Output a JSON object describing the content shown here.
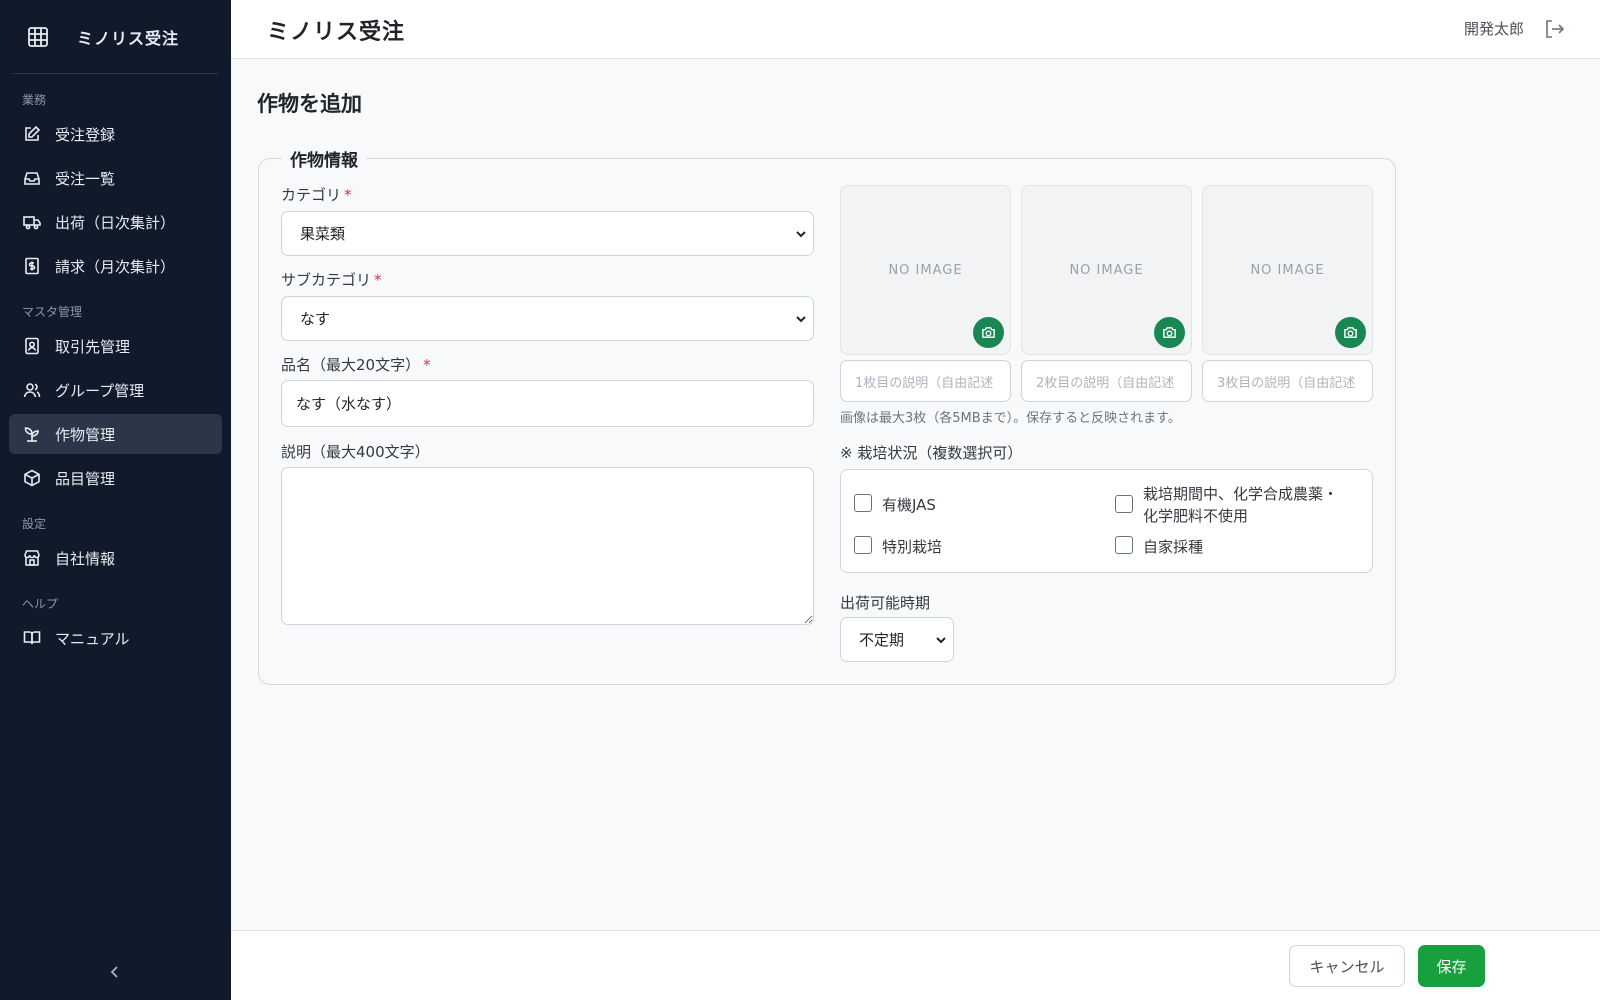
{
  "sidebar": {
    "brand": "ミノリス受注",
    "sections": [
      {
        "label": "業務",
        "items": [
          {
            "label": "受注登録",
            "icon": "edit-icon"
          },
          {
            "label": "受注一覧",
            "icon": "inbox-icon"
          },
          {
            "label": "出荷（日次集計）",
            "icon": "truck-icon"
          },
          {
            "label": "請求（月次集計）",
            "icon": "invoice-icon"
          }
        ]
      },
      {
        "label": "マスタ管理",
        "items": [
          {
            "label": "取引先管理",
            "icon": "contact-card-icon"
          },
          {
            "label": "グループ管理",
            "icon": "people-icon"
          },
          {
            "label": "作物管理",
            "icon": "sprout-icon",
            "active": true
          },
          {
            "label": "品目管理",
            "icon": "box-icon"
          }
        ]
      },
      {
        "label": "設定",
        "items": [
          {
            "label": "自社情報",
            "icon": "shop-icon"
          }
        ]
      },
      {
        "label": "ヘルプ",
        "items": [
          {
            "label": "マニュアル",
            "icon": "book-icon"
          }
        ]
      }
    ]
  },
  "header": {
    "title": "ミノリス受注",
    "user": "開発太郎"
  },
  "page": {
    "title": "作物を追加",
    "legend": "作物情報"
  },
  "form": {
    "category": {
      "label": "カテゴリ",
      "value": "果菜類",
      "required_mark": "*"
    },
    "subcategory": {
      "label": "サブカテゴリ",
      "value": "なす",
      "required_mark": "*"
    },
    "name": {
      "label": "品名（最大20文字）",
      "value": "なす（水なす）",
      "required_mark": "*"
    },
    "description": {
      "label": "説明（最大400文字）",
      "value": ""
    },
    "images": [
      {
        "no_image": "NO IMAGE",
        "placeholder": "1枚目の説明（自由記述"
      },
      {
        "no_image": "NO IMAGE",
        "placeholder": "2枚目の説明（自由記述"
      },
      {
        "no_image": "NO IMAGE",
        "placeholder": "3枚目の説明（自由記述"
      }
    ],
    "image_hint": "画像は最大3枚（各5MBまで）。保存すると反映されます。",
    "cultivation": {
      "label": "※ 栽培状況（複数選択可）",
      "options": [
        {
          "label": "有機JAS",
          "checked": false
        },
        {
          "label": "栽培期間中、化学合成農薬・化学肥料不使用",
          "line1": "栽培期間中、化学合成農薬・",
          "line2": "化学肥料不使用",
          "checked": false
        },
        {
          "label": "特別栽培",
          "checked": false
        },
        {
          "label": "自家採種",
          "checked": false
        }
      ]
    },
    "shipping_period": {
      "label": "出荷可能時期",
      "value": "不定期"
    }
  },
  "footer": {
    "cancel": "キャンセル",
    "save": "保存"
  },
  "colors": {
    "sidebar_bg": "#111a2b",
    "accent_green": "#18a03e",
    "camera_green": "#198754",
    "required_red": "#dc3545"
  }
}
